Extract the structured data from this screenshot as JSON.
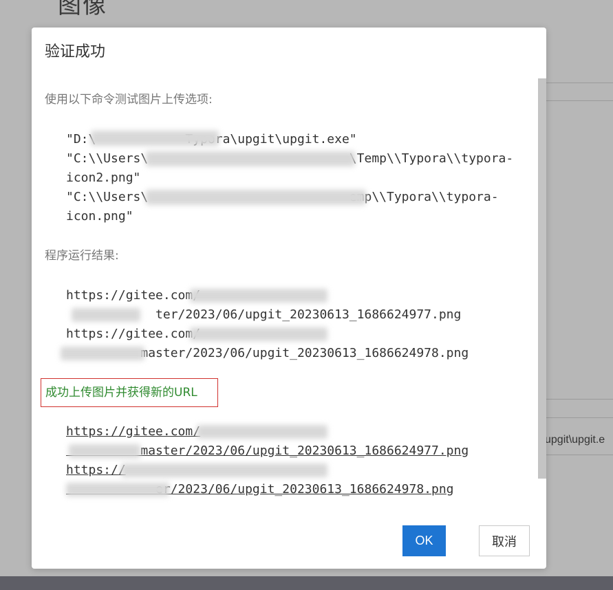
{
  "background": {
    "heading": "图像",
    "input_text": "upgit\\upgit.e"
  },
  "dialog": {
    "title": "验证成功",
    "command_label": "使用以下命令测试图片上传选项:",
    "command_lines": [
      "\"D:\\            Typora\\upgit\\upgit.exe\"",
      "\"C:\\\\Users\\                           \\Temp\\\\Typora\\\\typora-",
      "icon2.png\"",
      "\"C:\\\\Users\\                           emp\\\\Typora\\\\typora-",
      "icon.png\""
    ],
    "result_label": "程序运行结果:",
    "result_lines": [
      "https://gitee.com/",
      "            ter/2023/06/upgit_20230613_1686624977.png",
      "https://gitee.com/",
      "          master/2023/06/upgit_20230613_1686624978.png"
    ],
    "success_message": "成功上传图片并获得新的URL",
    "url_lines": [
      "https://gitee.com/",
      "          master/2023/06/upgit_20230613_1686624977.png",
      "https://",
      "            er/2023/06/upgit_20230613_1686624978.png"
    ],
    "ok_label": "OK",
    "cancel_label": "取消"
  },
  "colors": {
    "ok_button": "#1e75d2",
    "success_text": "#2f8a2f",
    "success_border": "#d0312d"
  }
}
